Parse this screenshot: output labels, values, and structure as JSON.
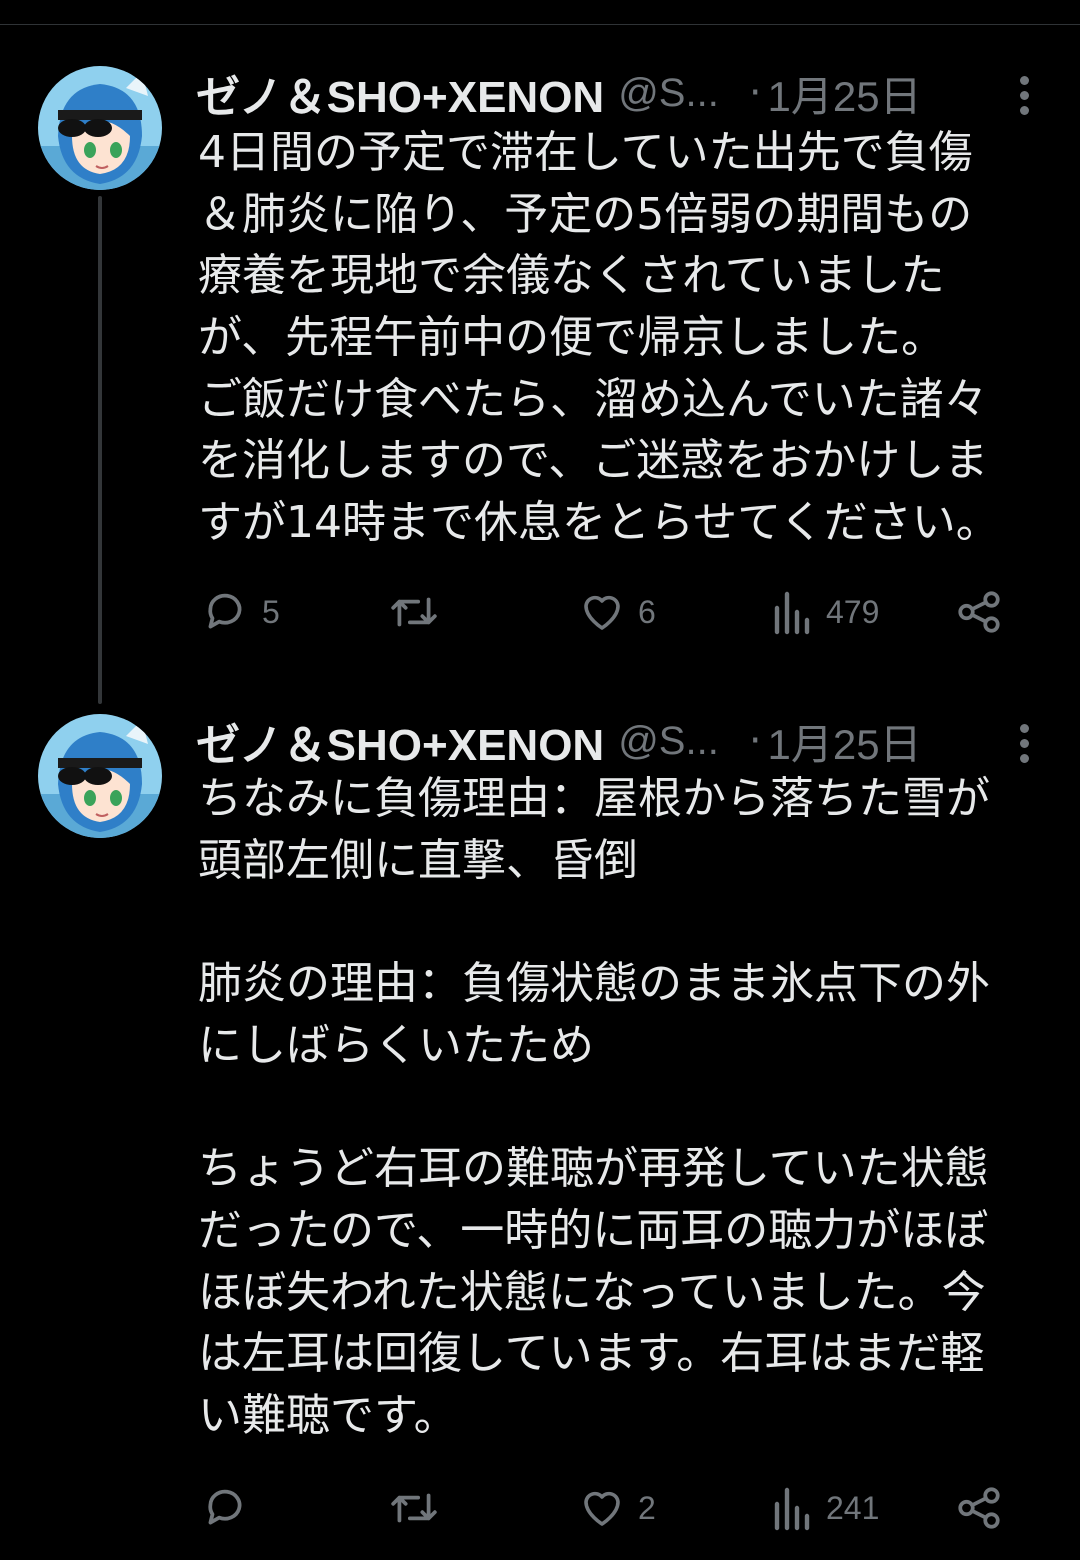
{
  "colors": {
    "background": "#000000",
    "text": "#e7e9ea",
    "muted": "#71767b",
    "thread_line": "#333639"
  },
  "tweets": [
    {
      "name": "ゼノ＆SHO+XENON",
      "handle": "@S...",
      "separator": "·",
      "date": "1月25日",
      "lines": [
        "4日間の予定で滞在していた出先で負傷",
        "＆肺炎に陥り、予定の5倍弱の期間もの",
        "療養を現地で余儀なくされていました",
        "が、先程午前中の便で帰京しました。",
        "ご飯だけ食べたら、溜め込んでいた諸々",
        "を消化しますので、ご迷惑をおかけしま",
        "すが14時まで休息をとらせてください。"
      ],
      "replies": "5",
      "retweets": "",
      "likes": "6",
      "views": "479",
      "icons": [
        "avatar",
        "more-icon",
        "reply-icon",
        "retweet-icon",
        "like-icon",
        "views-icon",
        "share-icon"
      ]
    },
    {
      "name": "ゼノ＆SHO+XENON",
      "handle": "@S...",
      "separator": "·",
      "date": "1月25日",
      "lines": [
        "ちなみに負傷理由：屋根から落ちた雪が",
        "頭部左側に直撃、昏倒",
        "",
        "肺炎の理由：負傷状態のまま氷点下の外",
        "にしばらくいたため",
        "",
        "ちょうど右耳の難聴が再発していた状態",
        "だったので、一時的に両耳の聴力がほぼ",
        "ほぼ失われた状態になっていました。今",
        "は左耳は回復しています。右耳はまだ軽",
        "い難聴です。"
      ],
      "replies": "",
      "retweets": "",
      "likes": "2",
      "views": "241",
      "icons": [
        "avatar",
        "more-icon",
        "reply-icon",
        "retweet-icon",
        "like-icon",
        "views-icon",
        "share-icon"
      ]
    }
  ]
}
